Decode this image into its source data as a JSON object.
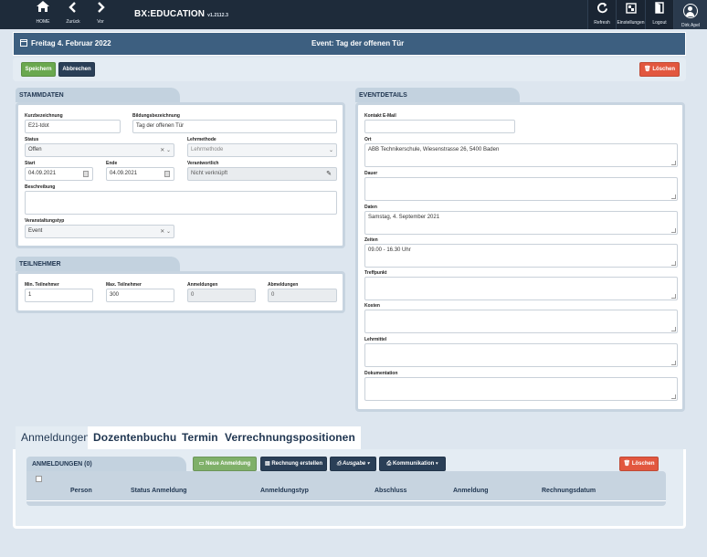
{
  "topbar": {
    "home_label": "HOME",
    "back_label": "Zurück",
    "forward_label": "Vor",
    "app_title": "BX:EDUCATION",
    "app_version": "v1.2112.3",
    "refresh_label": "Refresh",
    "settings_label": "Einstellungen",
    "logout_label": "Logout",
    "user_label": "Dirk Apel"
  },
  "header": {
    "date": "Freitag 4. Februar 2022",
    "title": "Event: Tag der offenen Tür"
  },
  "toolbar": {
    "save_label": "Speichern",
    "cancel_label": "Abbrechen",
    "delete_label": "Löschen"
  },
  "stammdaten": {
    "section_title": "STAMMDATEN",
    "kurz_label": "Kurzbezeichnung",
    "kurz_value": "E21-tdot",
    "bildung_label": "Bildungsbezeichnung",
    "bildung_value": "Tag der offenen Tür",
    "status_label": "Status",
    "status_value": "Offen",
    "lehrmethode_label": "Lehrmethode",
    "lehrmethode_value": "Lehrmethode",
    "start_label": "Start",
    "start_value": "04.09.2021",
    "ende_label": "Ende",
    "ende_value": "04.09.2021",
    "verantwortlich_label": "Verantwortlich",
    "verantwortlich_value": "Nicht verknüpft",
    "beschreibung_label": "Beschreibung",
    "beschreibung_value": "",
    "typ_label": "Veranstaltungstyp",
    "typ_value": "Event"
  },
  "teilnehmer": {
    "section_title": "TEILNEHMER",
    "min_label": "Min. Teilnehmer",
    "min_value": "1",
    "max_label": "Max. Teilnehmer",
    "max_value": "300",
    "anmeldungen_label": "Anmeldungen",
    "anmeldungen_value": "0",
    "abmeldungen_label": "Abmeldungen",
    "abmeldungen_value": "0"
  },
  "eventdetails": {
    "section_title": "EVENTDETAILS",
    "email_label": "Kontakt E-Mail",
    "email_value": "",
    "ort_label": "Ort",
    "ort_value": "ABB Technikerschule, Wiesenstrasse 26, 5400 Baden",
    "dauer_label": "Dauer",
    "dauer_value": "",
    "daten_label": "Daten",
    "daten_value": "Samstag, 4. September 2021",
    "zeiten_label": "Zeiten",
    "zeiten_value": "09.00 - 16.30 Uhr",
    "treffpunkt_label": "Treffpunkt",
    "treffpunkt_value": "",
    "kosten_label": "Kosten",
    "kosten_value": "",
    "lehrmittel_label": "Lehrmittel",
    "lehrmittel_value": "",
    "doku_label": "Dokumentation",
    "doku_value": ""
  },
  "bottom_tabs": {
    "tab1": "Anmeldungen",
    "tab2": "Dozentenbuchung",
    "tab3": "Termin",
    "tab4": "Verrechnungspositionen"
  },
  "anmeldungen": {
    "section_title": "ANMELDUNGEN (0)",
    "new_label": "Neue Anmeldung",
    "bill_label": "Rechnung erstellen",
    "output_label": "Ausgabe",
    "comm_label": "Kommunikation",
    "delete_label": "Löschen",
    "columns": [
      "Person",
      "Status Anmeldung",
      "Anmeldungstyp",
      "Abschluss",
      "Anmeldung",
      "Rechnungsdatum"
    ]
  },
  "icons": {
    "home": "home-icon",
    "back": "chevron-left-icon",
    "forward": "chevron-right-icon",
    "refresh": "refresh-icon",
    "settings": "settings-icon",
    "logout": "logout-icon",
    "user": "user-icon",
    "calendar": "calendar-icon",
    "trash": "trash-icon",
    "pencil": "pencil-icon",
    "printer": "printer-icon"
  },
  "colors": {
    "topbar": "#1e2b3a",
    "header": "#3d5f80",
    "save": "#6aa84f",
    "dark_button": "#2a3f57",
    "delete": "#e2573f",
    "panel_tab": "#c3d2df"
  }
}
